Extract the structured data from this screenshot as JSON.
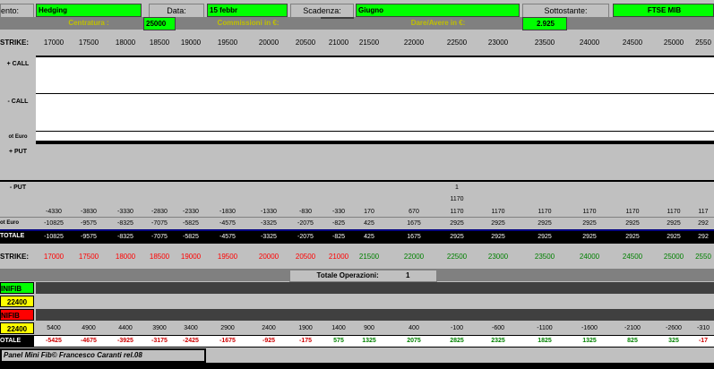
{
  "header": {
    "row1": {
      "strategy_label": "ento:",
      "strategy_value": "Hedging",
      "data_label": "Data:",
      "data_value": "15 febbr",
      "scadenza_label": "Scadenza:",
      "scadenza_value": "Giugno",
      "sottostante_label": "Sottostante:",
      "sottostante_value": "FTSE MIB"
    },
    "row2": {
      "centratura_label": "Centratura :",
      "centratura_value": "25000",
      "commissioni_label": "Commissioni in €:",
      "commissioni_value": "",
      "dare_avere_label": "Dare/Avere in €:",
      "dare_avere_value": "2.925"
    }
  },
  "strike_label": "STRIKE:",
  "strikes": [
    "17000",
    "17500",
    "18000",
    "18500",
    "19000",
    "19500",
    "20000",
    "20500",
    "21000",
    "21500",
    "22000",
    "22500",
    "23000",
    "23500",
    "24000",
    "24500",
    "25000",
    "2550"
  ],
  "section_labels": {
    "plus_call": "+ CALL",
    "minus_call": "- CALL",
    "tot_euro_call": "ot Euro",
    "plus_put": "+ PUT",
    "minus_put": "- PUT",
    "tot_euro_put": "ot Euro",
    "totale": "TOTALE"
  },
  "put_qty_marker": "1",
  "put_qty_price": "1170",
  "minus_put_row": [
    "-4330",
    "-3830",
    "-3330",
    "-2830",
    "-2330",
    "-1830",
    "-1330",
    "-830",
    "-330",
    "170",
    "670",
    "1170",
    "1170",
    "1170",
    "1170",
    "1170",
    "1170",
    "117"
  ],
  "tot_euro_row": [
    "-10825",
    "-9575",
    "-8325",
    "-7075",
    "-5825",
    "-4575",
    "-3325",
    "-2075",
    "-825",
    "425",
    "1675",
    "2925",
    "2925",
    "2925",
    "2925",
    "2925",
    "2925",
    "292"
  ],
  "totale_row": [
    "-10825",
    "-9575",
    "-8325",
    "-7075",
    "-5825",
    "-4575",
    "-3325",
    "-2075",
    "-825",
    "425",
    "1675",
    "2925",
    "2925",
    "2925",
    "2925",
    "2925",
    "2925",
    "292"
  ],
  "strike2_label": "STRIKE:",
  "totale_operazioni_label": "Totale Operazioni:",
  "totale_operazioni_value": "1",
  "minifib": {
    "label1": "INIFIB",
    "value1": "22400",
    "label2": "NIFIB",
    "value2": "22400"
  },
  "minifib_row": [
    "5400",
    "4900",
    "4400",
    "3900",
    "3400",
    "2900",
    "2400",
    "1900",
    "1400",
    "900",
    "400",
    "-100",
    "-600",
    "-1100",
    "-1600",
    "-2100",
    "-2600",
    "-310"
  ],
  "bottom_totale_label": "OTALE",
  "bottom_totale_row": [
    "-5425",
    "-4675",
    "-3925",
    "-3175",
    "-2425",
    "-1675",
    "-925",
    "-175",
    "575",
    "1325",
    "2075",
    "2825",
    "2325",
    "1825",
    "1325",
    "825",
    "325",
    "-17"
  ],
  "footer": "Panel Mini Fib©  Francesco Caranti  rel.08",
  "colors": {
    "green": "#00ff00",
    "yellow": "#ffff00",
    "red": "#ff0000",
    "negative_strike": "#ff0000",
    "positive_strike": "#008000"
  }
}
